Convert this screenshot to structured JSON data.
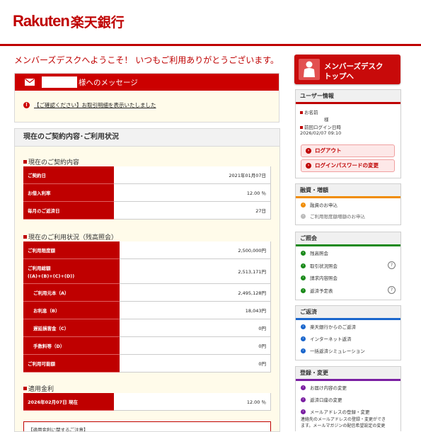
{
  "brand": {
    "logo_en": "Rakuten",
    "logo_jp": "楽天銀行",
    "color": "#bf0000"
  },
  "welcome": "メンバーズデスクへようこそ！ いつもご利用ありがとうございます。",
  "message": {
    "title": "様へのメッセージ",
    "item": "【ご確認ください】お取引明細を表示いたしました"
  },
  "contract_panel": {
    "title": "現在のご契約内容･ご利用状況",
    "section1": "現在のご契約内容",
    "rows1": [
      {
        "label": "ご契約日",
        "value": "2021年01月07日"
      },
      {
        "label": "お借入利率",
        "value": "12.00 ％"
      },
      {
        "label": "毎月のご返済日",
        "value": "27日"
      }
    ],
    "section2": "現在のご利用状況（残高照会）",
    "rows2": [
      {
        "label": "ご利用限度額",
        "value": "2,500,000円"
      },
      {
        "label": "ご利用総額",
        "label2": "((A)+(B)+(C)+(D))",
        "value": "2,513,171円"
      },
      {
        "label": "ご利用元本（A）",
        "value": "2,495,128円"
      },
      {
        "label": "お利息（B）",
        "value": "18,043円"
      },
      {
        "label": "遅延損害金（C）",
        "value": "0円"
      },
      {
        "label": "手数料等（D）",
        "value": "0円"
      },
      {
        "label": "ご利用可能額",
        "value": "0円"
      }
    ],
    "section3": "適用金利",
    "rows3": [
      {
        "label": "2026年02月07日 現在",
        "value": "12.00 ％"
      }
    ],
    "note": "【適用金利に関するご注意】"
  },
  "member_button": {
    "line1": "メンバーズデスク",
    "line2": "トップへ"
  },
  "user_info": {
    "title": "ユーザー情報",
    "name_label": "お名前",
    "name_suffix": "様",
    "login_label": "前回ログイン日時",
    "login_value": "2026/02/07 09:10",
    "logout": "ログアウト",
    "change_password": "ログインパスワードの変更"
  },
  "loan": {
    "title": "融資・増額",
    "items": [
      "融資のお申込",
      "ご利用限度額増額のお申込"
    ]
  },
  "inquiry": {
    "title": "ご照会",
    "items": [
      "残高照会",
      "取引状況照会",
      "請求内容照会",
      "返済予定表"
    ]
  },
  "repay": {
    "title": "ご返済",
    "items": [
      "楽天銀行からのご返済",
      "インターネット返済",
      "一括返済シミュレーション"
    ]
  },
  "settings": {
    "title": "登録・変更",
    "items": [
      "お届け内容の変更",
      "返済口座の変更",
      "メールアドレスの登録・変更"
    ],
    "desc1": "連絡先のメールアドレスの登録・変更ができ",
    "desc2": "ます。メールマガジンの配信希望設定の変更"
  }
}
